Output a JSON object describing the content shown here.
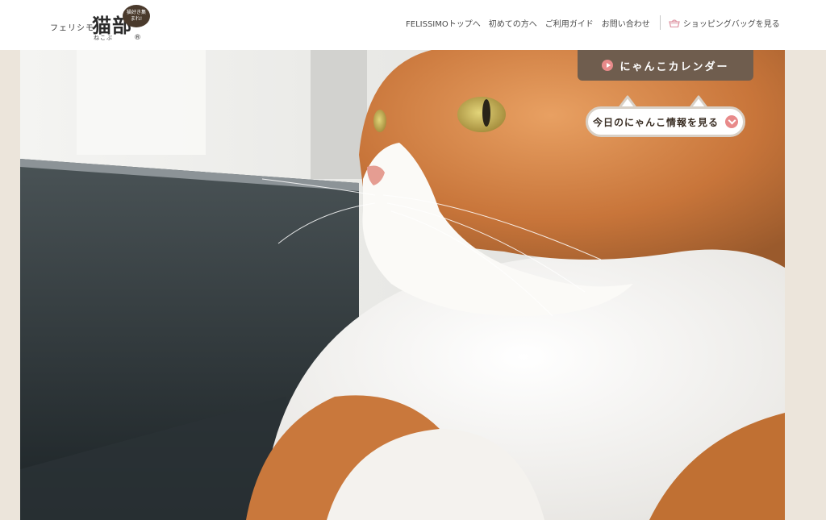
{
  "header": {
    "logo": {
      "prefix": "フェリシモ",
      "main": "猫部",
      "reading": "ねこぶ",
      "bubble": "猫好き集まれ!",
      "registered": "®"
    },
    "nav": [
      {
        "label": "FELISSIMOトップへ"
      },
      {
        "label": "初めての方へ"
      },
      {
        "label": "ご利用ガイド"
      },
      {
        "label": "お問い合わせ"
      }
    ],
    "bag_label": "ショッピングバッグを見る",
    "bag_icon": "shopping-bag-icon"
  },
  "hero": {
    "calendar_label": "にゃんこカレンダー",
    "today_label": "今日のにゃんこ情報を見る"
  },
  "colors": {
    "accent_pink": "#e88a8a",
    "tab_brown": "#6f5d4e",
    "frame_beige": "#ece5db"
  }
}
